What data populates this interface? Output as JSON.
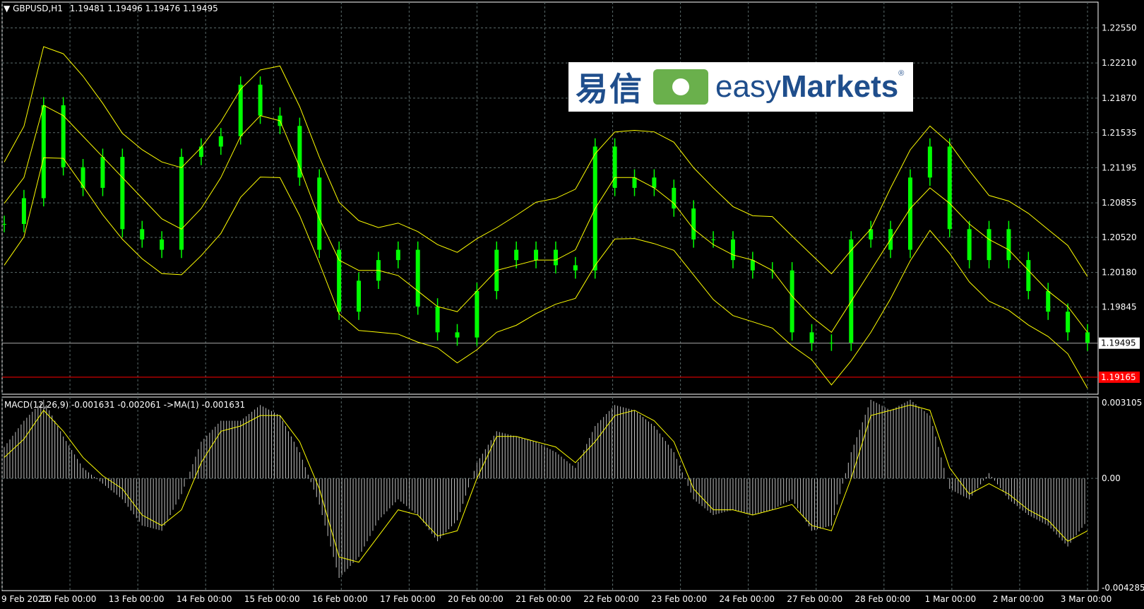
{
  "header": {
    "symbol_label": "GBPUSD,H1",
    "ohlc": "1.19481 1.19496 1.19476 1.19495",
    "indicator_label": "MACD(12,26,9) -0.001631 -0.002061  ->MA(1) -0.001631"
  },
  "logo": {
    "cn_text": "易信",
    "en_prefix": "easy",
    "en_brand": "Markets",
    "reg_mark": "®"
  },
  "colors": {
    "background": "#000000",
    "candles": "#00ff00",
    "bands": "#ffff00",
    "macd_hist": "#c0c0c0",
    "signal": "#ffff00",
    "grid": "#5a6a6a",
    "red_level": "#ff0000"
  },
  "chart_data": [
    {
      "type": "line",
      "title": "GBPUSD,H1",
      "ylim": [
        1.19,
        1.228
      ],
      "y_ticks": [
        "1.22550",
        "1.22210",
        "1.21870",
        "1.21535",
        "1.21195",
        "1.20855",
        "1.20520",
        "1.20180",
        "1.19845"
      ],
      "current_price": "1.19495",
      "level_price": "1.19165",
      "x": [
        "9 Feb 2023",
        "10 Feb 00:00",
        "13 Feb 00:00",
        "14 Feb 00:00",
        "15 Feb 00:00",
        "16 Feb 00:00",
        "17 Feb 00:00",
        "20 Feb 00:00",
        "21 Feb 00:00",
        "22 Feb 00:00",
        "23 Feb 00:00",
        "24 Feb 00:00",
        "27 Feb 00:00",
        "28 Feb 00:00",
        "1 Mar 00:00",
        "2 Mar 00:00",
        "3 Mar 00:00"
      ],
      "series": [
        {
          "values": [
            1.2065,
            1.209,
            1.218,
            1.212,
            1.21,
            1.213,
            1.206,
            1.205,
            1.204,
            1.213,
            1.214,
            1.215,
            1.22,
            1.217,
            1.216,
            1.211,
            1.204,
            1.198,
            1.201,
            1.203,
            1.204,
            1.1985,
            1.196,
            1.1955,
            1.2,
            1.204,
            1.203,
            1.204,
            1.2025,
            1.202,
            1.214,
            1.21,
            1.211,
            1.21,
            1.208,
            1.205,
            1.205,
            1.203,
            1.202,
            1.202,
            1.196,
            1.195,
            1.195,
            1.205,
            1.206,
            1.204,
            1.211,
            1.214,
            1.206,
            1.203,
            1.206,
            1.203,
            1.2,
            1.198,
            1.196,
            1.195
          ]
        },
        {
          "name": "",
          "values": [
            1.2085,
            1.211,
            1.218,
            1.217,
            1.215,
            1.213,
            1.211,
            1.209,
            1.207,
            1.206,
            1.208,
            1.211,
            1.215,
            1.217,
            1.2165,
            1.212,
            1.207,
            1.203,
            1.202,
            1.202,
            1.2015,
            1.2,
            1.1985,
            1.198,
            1.2,
            1.202,
            1.2025,
            1.203,
            1.203,
            1.204,
            1.208,
            1.211,
            1.211,
            1.21,
            1.2085,
            1.206,
            1.2045,
            1.2035,
            1.203,
            1.202,
            1.1995,
            1.1975,
            1.196,
            1.199,
            1.202,
            1.205,
            1.208,
            1.21,
            1.2085,
            1.2065,
            1.205,
            1.204,
            1.202,
            1.2,
            1.1985,
            1.196
          ]
        }
      ]
    },
    {
      "type": "bar",
      "title": "MACD(12,26,9)",
      "ylim": [
        -0.004285,
        0.003105
      ],
      "y_ticks": [
        "0.003105",
        "0.00",
        "-0.004285"
      ],
      "series": [
        {
          "values": [
            0.0012,
            0.0022,
            0.003,
            0.0016,
            0.0004,
            -0.0002,
            -0.0008,
            -0.0018,
            -0.002,
            -0.0006,
            0.0014,
            0.0022,
            0.0022,
            0.0028,
            0.0024,
            0.001,
            -0.001,
            -0.0038,
            -0.003,
            -0.0016,
            -0.0008,
            -0.0014,
            -0.0024,
            -0.0016,
            0.0006,
            0.0018,
            0.0016,
            0.0014,
            0.001,
            0.0004,
            0.002,
            0.0028,
            0.0026,
            0.002,
            0.001,
            -0.0008,
            -0.0014,
            -0.0012,
            -0.0014,
            -0.0012,
            -0.0008,
            -0.002,
            -0.0018,
            0.001,
            0.003,
            0.0026,
            0.003,
            0.0024,
            -0.0004,
            -0.0008,
            0.0002,
            -0.0008,
            -0.0014,
            -0.0018,
            -0.0026,
            -0.0016
          ]
        },
        {
          "values": [
            0.0008,
            0.0015,
            0.0026,
            0.0018,
            0.0008,
            0.0001,
            -0.0004,
            -0.0014,
            -0.0018,
            -0.0012,
            0.0006,
            0.0018,
            0.002,
            0.0024,
            0.0024,
            0.0014,
            -0.0004,
            -0.003,
            -0.0032,
            -0.0022,
            -0.0012,
            -0.0014,
            -0.0022,
            -0.002,
            0.0,
            0.0016,
            0.0016,
            0.0014,
            0.0012,
            0.0006,
            0.0014,
            0.0024,
            0.0026,
            0.0022,
            0.0014,
            -0.0004,
            -0.0012,
            -0.0012,
            -0.0014,
            -0.0012,
            -0.001,
            -0.0018,
            -0.002,
            0.0,
            0.0024,
            0.0026,
            0.0028,
            0.0026,
            0.0004,
            -0.0006,
            -0.0002,
            -0.0006,
            -0.0012,
            -0.0016,
            -0.0024,
            -0.002
          ]
        }
      ]
    }
  ]
}
